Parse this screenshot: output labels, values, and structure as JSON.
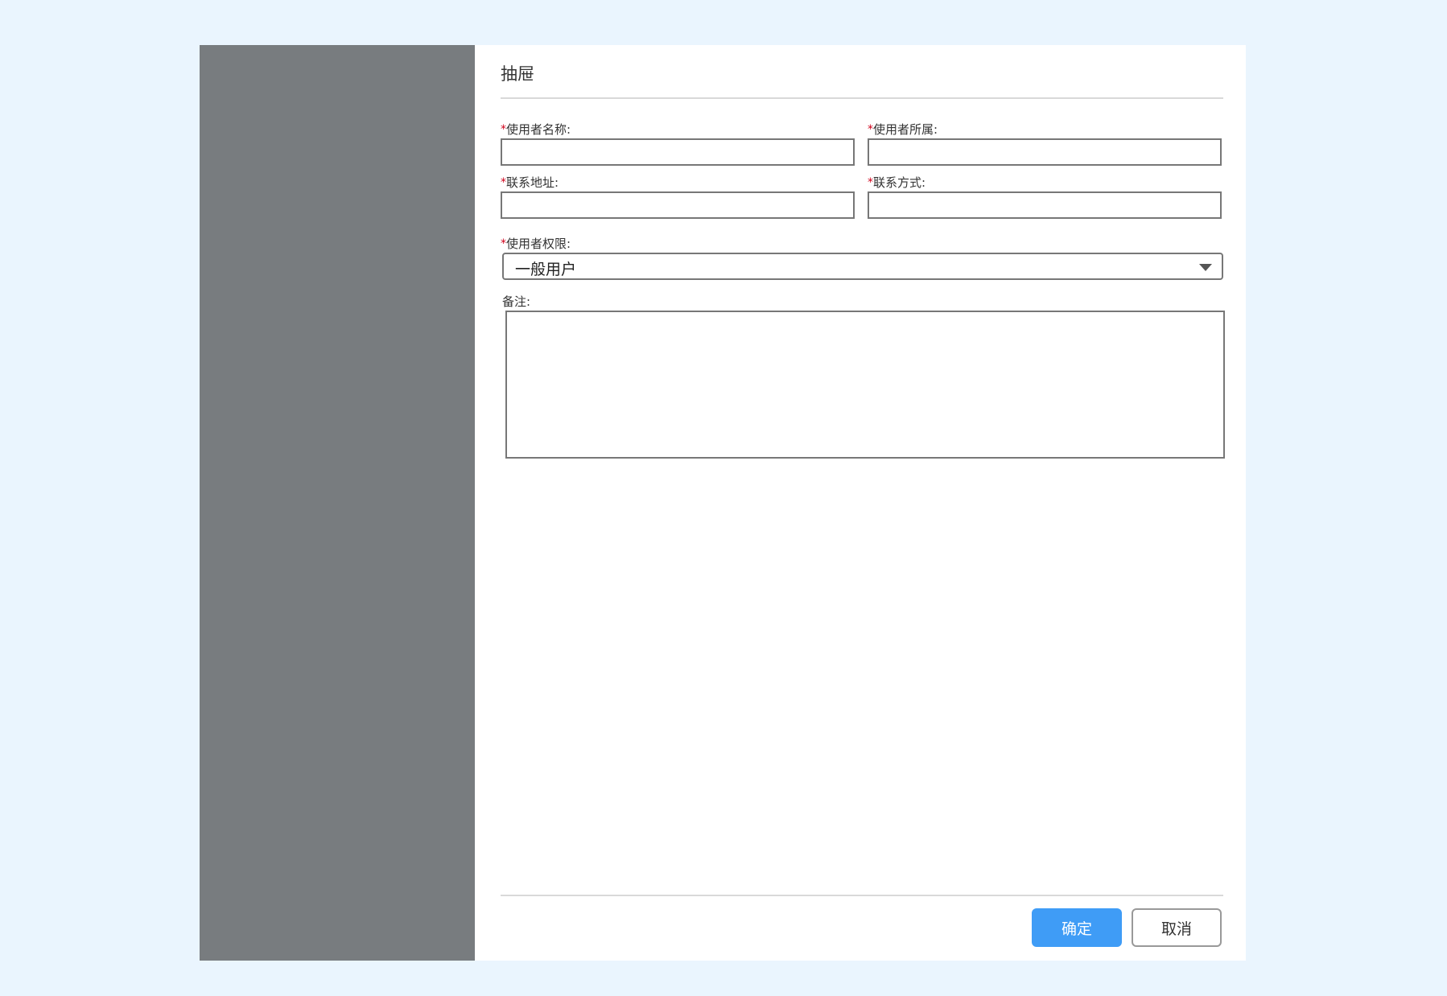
{
  "drawer": {
    "title": "抽屉"
  },
  "form": {
    "required_mark": "*",
    "user_name": {
      "label": "使用者名称:",
      "value": "",
      "placeholder": ""
    },
    "user_affiliation": {
      "label": "使用者所属:",
      "value": "",
      "placeholder": ""
    },
    "contact_address": {
      "label": "联系地址:",
      "value": "",
      "placeholder": ""
    },
    "contact_method": {
      "label": "联系方式:",
      "value": "",
      "placeholder": ""
    },
    "user_permission": {
      "label": "使用者权限:",
      "selected": "一般用户"
    },
    "remarks": {
      "label": "备注:",
      "value": ""
    }
  },
  "footer": {
    "confirm_label": "确定",
    "cancel_label": "取消"
  },
  "colors": {
    "background": "#eaf5fe",
    "overlay": "#787c7f",
    "primary": "#3f9cf6",
    "required": "#d0021b"
  }
}
